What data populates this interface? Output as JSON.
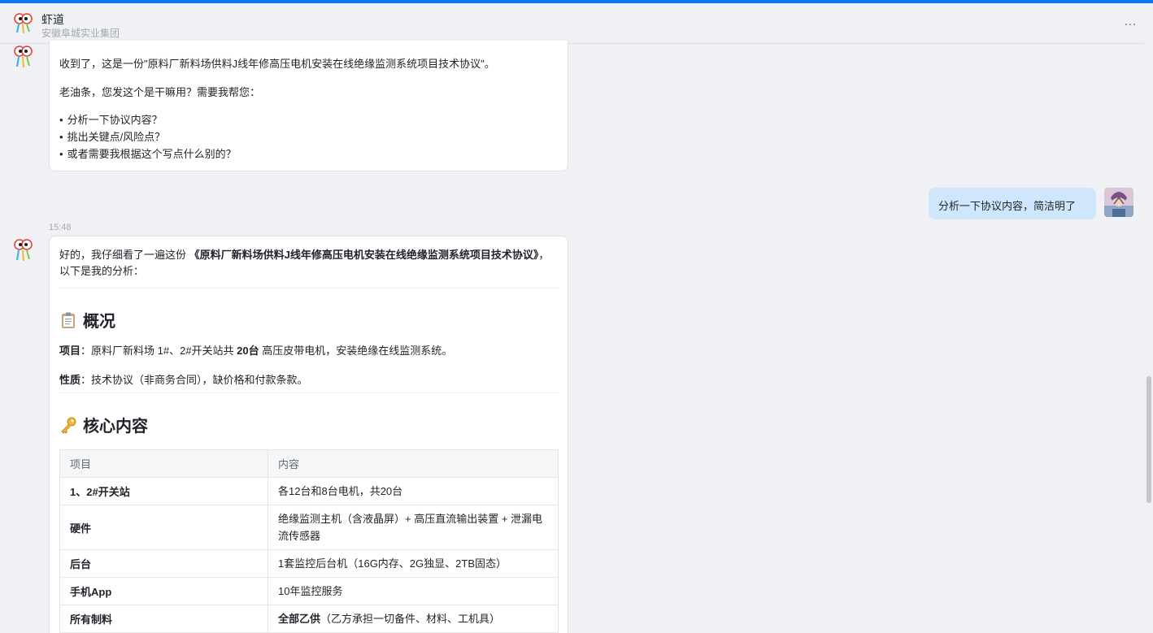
{
  "colors": {
    "accent": "#0b79f0",
    "user_bubble": "#cfe6fc",
    "background": "#f0f1f4"
  },
  "header": {
    "title": "虾道",
    "subtitle": "安徽阜城实业集团",
    "more_icon": "…"
  },
  "messages": {
    "bot1": {
      "line1": "收到了，这是一份\"原料厂新料场供料J线年修高压电机安装在线绝缘监测系统项目技术协议\"。",
      "line2": "老油条，您发这个是干嘛用？需要我帮您：",
      "bullets": [
        "分析一下协议内容？",
        "挑出关键点/风险点？",
        "或者需要我根据这个写点什么别的？"
      ]
    },
    "user1": {
      "text": "分析一下协议内容，简洁明了"
    },
    "time": "15:48",
    "bot2": {
      "intro_prefix": "好的，我仔细看了一遍这份 ",
      "intro_title": "《原料厂新料场供料J线年修高压电机安装在线绝缘监测系统项目技术协议》",
      "intro_suffix": "，以下是我的分析：",
      "section1": {
        "icon": "clipboard-icon",
        "heading": "概况",
        "project_label": "项目",
        "project_text_a": "：原料厂新料场 1#、2#开关站共 ",
        "project_bold": "20台",
        "project_text_b": " 高压皮带电机，安装绝缘在线监测系统。",
        "nature_label": "性质",
        "nature_text": "：技术协议（非商务合同），缺价格和付款条款。"
      },
      "section2": {
        "icon": "key-icon",
        "heading": "核心内容",
        "table": {
          "headers": [
            "项目",
            "内容"
          ],
          "rows": [
            {
              "key": "1、2#开关站",
              "value": "各12台和8台电机，共20台",
              "value_bold": ""
            },
            {
              "key": "硬件",
              "value": "绝缘监测主机（含液晶屏）+ 高压直流输出装置 + 泄漏电流传感器",
              "value_bold": ""
            },
            {
              "key": "后台",
              "value": "1套监控后台机（16G内存、2G独显、2TB固态）",
              "value_bold": ""
            },
            {
              "key": "手机App",
              "value": "10年监控服务",
              "value_bold": ""
            },
            {
              "key": "所有制料",
              "value": "（乙方承担一切备件、材料、工机具）",
              "value_bold": "全部乙供"
            }
          ]
        }
      }
    }
  }
}
